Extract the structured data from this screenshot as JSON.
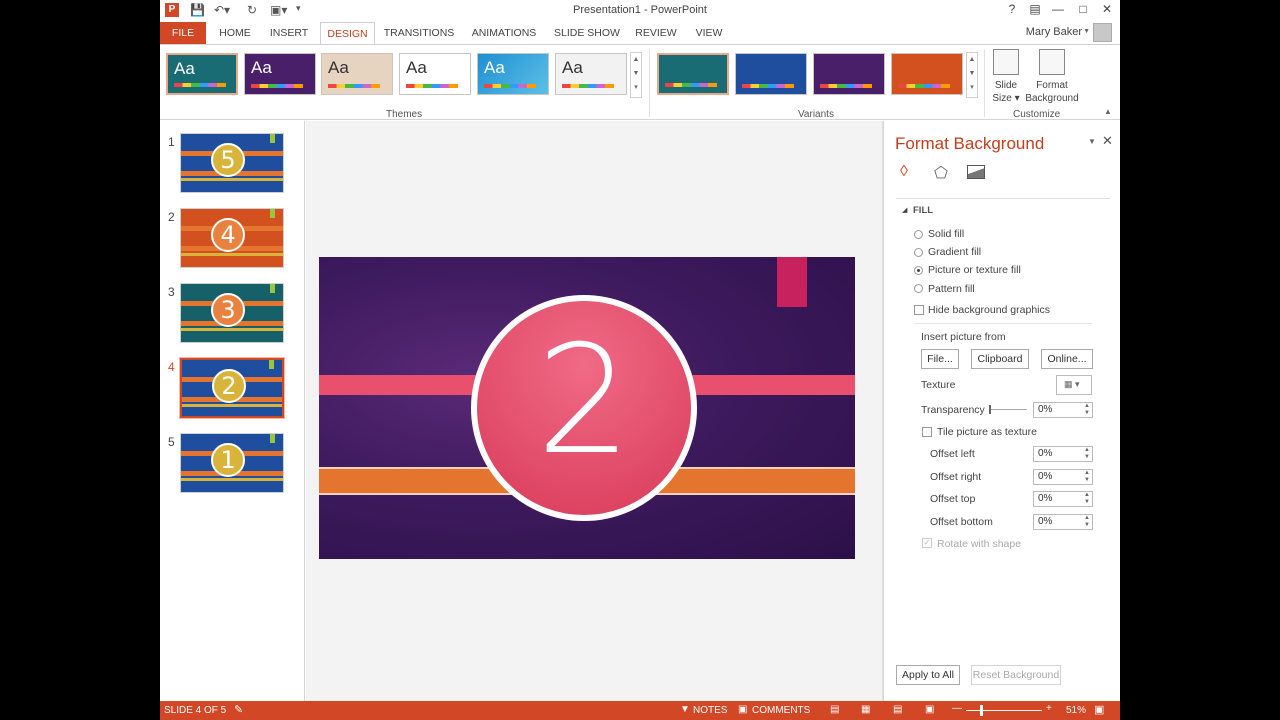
{
  "window": {
    "title": "Presentation1 - PowerPoint",
    "help": "?",
    "user": "Mary Baker"
  },
  "tabs": [
    "FILE",
    "HOME",
    "INSERT",
    "DESIGN",
    "TRANSITIONS",
    "ANIMATIONS",
    "SLIDE SHOW",
    "REVIEW",
    "VIEW"
  ],
  "ribbon": {
    "themes_label": "Themes",
    "variants_label": "Variants",
    "customize_label": "Customize",
    "theme_thumb_text": "Aa",
    "slide_size": "Slide Size",
    "slide_size_line1": "Slide",
    "slide_size_line2": "Size",
    "format_bg_line1": "Format",
    "format_bg_line2": "Background"
  },
  "slides": [
    {
      "number": "1",
      "digit": "5",
      "bg": "#1f4e9e",
      "circle": "#d9b43a"
    },
    {
      "number": "2",
      "digit": "4",
      "bg": "#d3501f",
      "circle": "#e8823e"
    },
    {
      "number": "3",
      "digit": "3",
      "bg": "#16606a",
      "circle": "#e8823e"
    },
    {
      "number": "4",
      "digit": "2",
      "bg": "#1f4e9e",
      "circle": "#d9b43a"
    },
    {
      "number": "5",
      "digit": "1",
      "bg": "#1f4e9e",
      "circle": "#d9b43a"
    }
  ],
  "main_slide": {
    "digit": "2"
  },
  "format_pane": {
    "title": "Format Background",
    "section": "FILL",
    "solid_fill": "Solid fill",
    "gradient_fill": "Gradient fill",
    "picture_fill": "Picture or texture fill",
    "pattern_fill": "Pattern fill",
    "hide_bg": "Hide background graphics",
    "insert_from": "Insert picture from",
    "file_btn": "File...",
    "clipboard_btn": "Clipboard",
    "online_btn": "Online...",
    "texture": "Texture",
    "transparency": "Transparency",
    "transparency_val": "0%",
    "tile": "Tile picture as texture",
    "offset_left": "Offset left",
    "offset_left_val": "0%",
    "offset_right": "Offset right",
    "offset_right_val": "0%",
    "offset_top": "Offset top",
    "offset_top_val": "0%",
    "offset_bottom": "Offset bottom",
    "offset_bottom_val": "0%",
    "rotate": "Rotate with shape",
    "apply_all": "Apply to All",
    "reset_bg": "Reset Background"
  },
  "status": {
    "slide_info": "SLIDE 4 OF 5",
    "notes": "NOTES",
    "comments": "COMMENTS",
    "zoom": "51%"
  },
  "colors": {
    "accent": "#d24726",
    "slide_circle": "#e8506e",
    "slide_band_top": "#e8506e",
    "slide_band_bottom": "#e5742e",
    "slide_bg": "#3e1a5e"
  }
}
